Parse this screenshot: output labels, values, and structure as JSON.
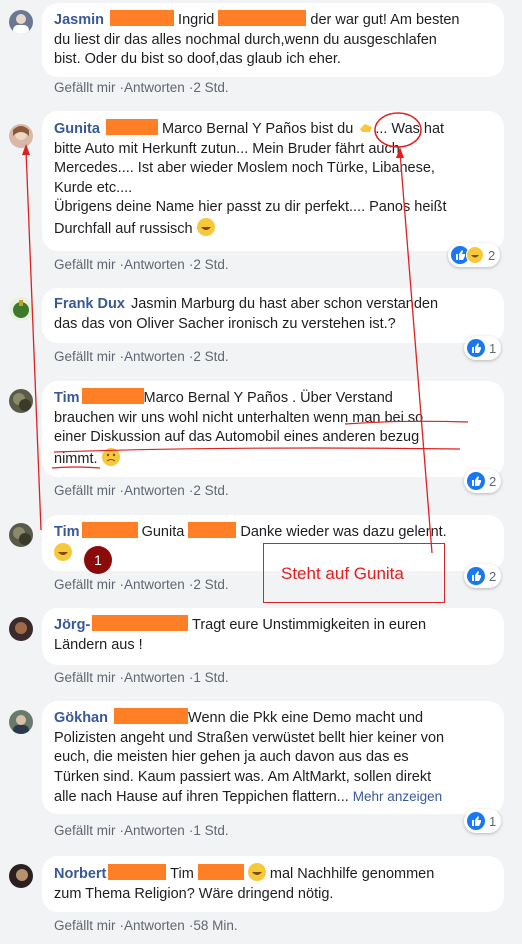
{
  "comments": [
    {
      "name": "Jasmin",
      "text": "Ingrid Heidemann der war gut! Am besten du liest dir das alles nochmal durch,wenn du ausgeschlafen bist. Oder du bist so doof,das glaub ich eher.",
      "line1": "Ingrid",
      "line1b": "der war gut! Am besten",
      "line2": "du liest dir das alles nochmal durch,wenn du ausgeschlafen",
      "line3": "bist. Oder du bist so doof,das glaub ich eher.",
      "like": "Gefällt mir",
      "reply": "Antworten",
      "time": "2 Std."
    },
    {
      "name": "Gunita",
      "line1": "Marco Bernal Y Paños bist du",
      "line1b": "... Was hat",
      "line2": "bitte Auto mit Herkunft zutun... Mein Bruder fährt auch",
      "line3": "Mercedes.... Ist aber wieder Moslem noch Türke, Libanese,",
      "line4": "Kurde etc....",
      "line5": "Übrigens deine Name hier passt zu dir perfekt.... Panos heißt",
      "line6": "Durchfall auf russisch",
      "like": "Gefällt mir",
      "reply": "Antworten",
      "time": "2 Std.",
      "reactions": "2"
    },
    {
      "name": "Frank Dux",
      "line1": "Jasmin Marburg du hast aber schon verstanden",
      "line2": "das das von Oliver Sacher ironisch zu verstehen ist.?",
      "like": "Gefällt mir",
      "reply": "Antworten",
      "time": "2 Std.",
      "reactions": "1"
    },
    {
      "name": "Tim",
      "line1": "Marco Bernal Y Paños . Über Verstand",
      "line2": "brauchen wir uns wohl nicht unterhalten wenn man bei so",
      "line3": "einer Diskussion auf das Automobil eines anderen bezug",
      "line4": "nimmt.",
      "like": "Gefällt mir",
      "reply": "Antworten",
      "time": "2 Std.",
      "reactions": "2"
    },
    {
      "name": "Tim",
      "line1": "Gunita",
      "line1b": "Danke wieder was dazu gelernt.",
      "like": "Gefällt mir",
      "reply": "Antworten",
      "time": "2 Std.",
      "reactions": "2"
    },
    {
      "name": "Jörg-",
      "line1": "Tragt eure Unstimmigkeiten in euren",
      "line2": "Ländern aus !",
      "like": "Gefällt mir",
      "reply": "Antworten",
      "time": "1 Std."
    },
    {
      "name": "Gökhan",
      "line1": "Wenn die Pkk eine Demo macht und",
      "line2": "Polizisten angeht und Straßen verwüstet bellt hier keiner von",
      "line3": "euch, die meisten hier gehen ja auch davon aus das es",
      "line4": "Türken sind. Kaum passiert was. Am AltMarkt, sollen direkt",
      "line5": "alle nach Hause auf ihren Teppichen flattern...",
      "more": "Mehr anzeigen",
      "like": "Gefällt mir",
      "reply": "Antworten",
      "time": "1 Std.",
      "reactions": "1"
    },
    {
      "name": "Norbert",
      "line1": "Tim",
      "line1b": "mal Nachhilfe genommen",
      "line2": "zum Thema Religion? Wäre dringend nötig.",
      "like": "Gefällt mir",
      "reply": "Antworten",
      "time": "58 Min."
    }
  ],
  "annotation": {
    "label": "Steht auf Gunita",
    "badge": "1",
    "color": "#e02020"
  },
  "colors": {
    "name": "#385898",
    "redaction": "#ff7f27",
    "like": "#1877f2",
    "background": "#f2f3f5"
  }
}
